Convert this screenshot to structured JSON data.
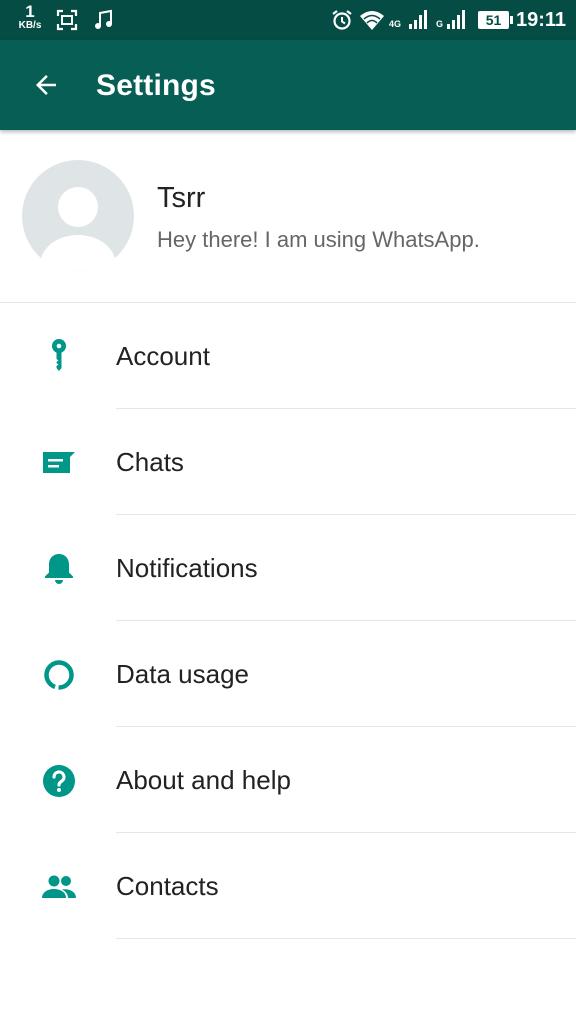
{
  "status_bar": {
    "speed_value": "1",
    "speed_unit": "KB/s",
    "network_1": "4G",
    "network_2": "G",
    "battery": "51",
    "time": "19:11",
    "icons": [
      "screenshot-icon",
      "music-icon",
      "alarm-icon",
      "wifi-icon",
      "signal-icon",
      "signal-icon",
      "battery-icon"
    ]
  },
  "app_bar": {
    "title": "Settings",
    "back_icon": "arrow-back-icon",
    "color": "#075e54"
  },
  "profile": {
    "name": "Tsrr",
    "status": "Hey there! I am using WhatsApp."
  },
  "menu": {
    "accent_color": "#009688",
    "items": [
      {
        "label": "Account",
        "icon": "key-icon"
      },
      {
        "label": "Chats",
        "icon": "chat-icon"
      },
      {
        "label": "Notifications",
        "icon": "bell-icon"
      },
      {
        "label": "Data usage",
        "icon": "data-usage-icon"
      },
      {
        "label": "About and help",
        "icon": "help-icon"
      },
      {
        "label": "Contacts",
        "icon": "contacts-icon"
      }
    ]
  }
}
